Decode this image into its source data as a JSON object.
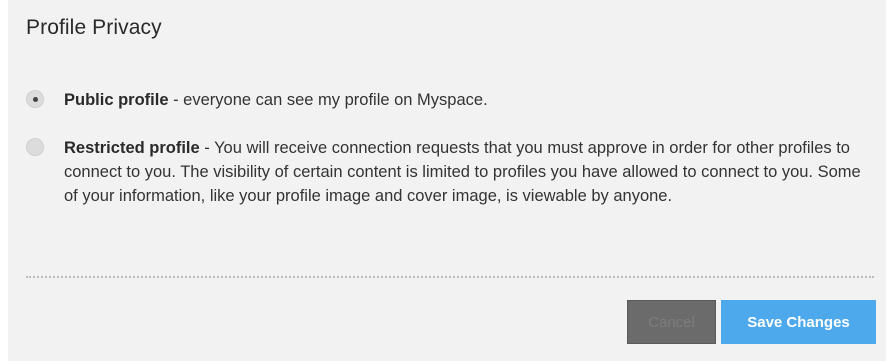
{
  "section": {
    "title": "Profile Privacy"
  },
  "options": [
    {
      "label": "Public profile",
      "description": " - everyone can see my profile on Myspace.",
      "selected": true
    },
    {
      "label": "Restricted profile",
      "description": " - You will receive connection requests that you must approve in order for other profiles to connect to you. The visibility of certain content is limited to profiles you have allowed to connect to you. Some of your information, like your profile image and cover image, is viewable by anyone.",
      "selected": false
    }
  ],
  "buttons": {
    "cancel_label": "Cancel",
    "save_label": "Save Changes"
  },
  "colors": {
    "save_button": "#4ea9ec",
    "cancel_button": "#6b6b6b",
    "panel_background": "#f2f2f2"
  }
}
